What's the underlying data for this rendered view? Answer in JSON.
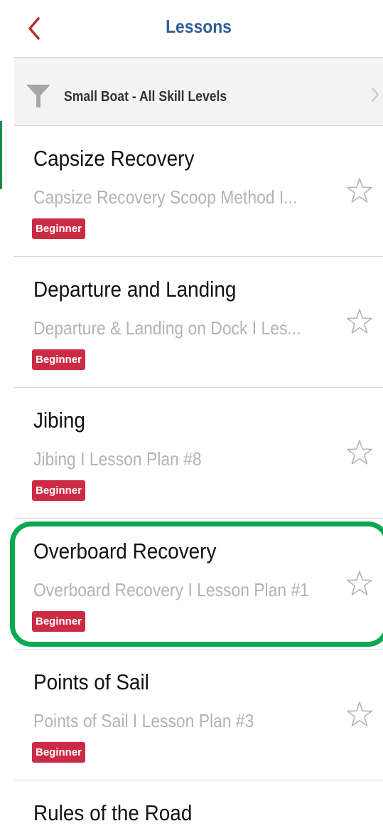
{
  "nav": {
    "title": "Lessons",
    "back_icon": "chevron-left-icon",
    "accent": "#b52d2d",
    "title_color": "#2f5f9a"
  },
  "filter": {
    "label": "Small Boat - All Skill Levels",
    "icon": "funnel-icon",
    "chevron": "chevron-right-icon"
  },
  "lessons": [
    {
      "title": "Capsize Recovery",
      "subtitle": "Capsize Recovery Scoop Method I...",
      "level": "Beginner"
    },
    {
      "title": "Departure and Landing",
      "subtitle": "Departure & Landing on Dock I Les...",
      "level": "Beginner"
    },
    {
      "title": "Jibing",
      "subtitle": "Jibing I Lesson Plan #8",
      "level": "Beginner"
    },
    {
      "title": "Overboard Recovery",
      "subtitle": "Overboard Recovery I Lesson Plan #1",
      "level": "Beginner"
    },
    {
      "title": "Points of Sail",
      "subtitle": "Points of Sail I Lesson Plan #3",
      "level": "Beginner"
    }
  ],
  "partial_row_title": "Rules of the Road",
  "colors": {
    "badge": "#cc2b44",
    "highlight": "#0aa84f",
    "subtitle": "#b3b3b3"
  }
}
